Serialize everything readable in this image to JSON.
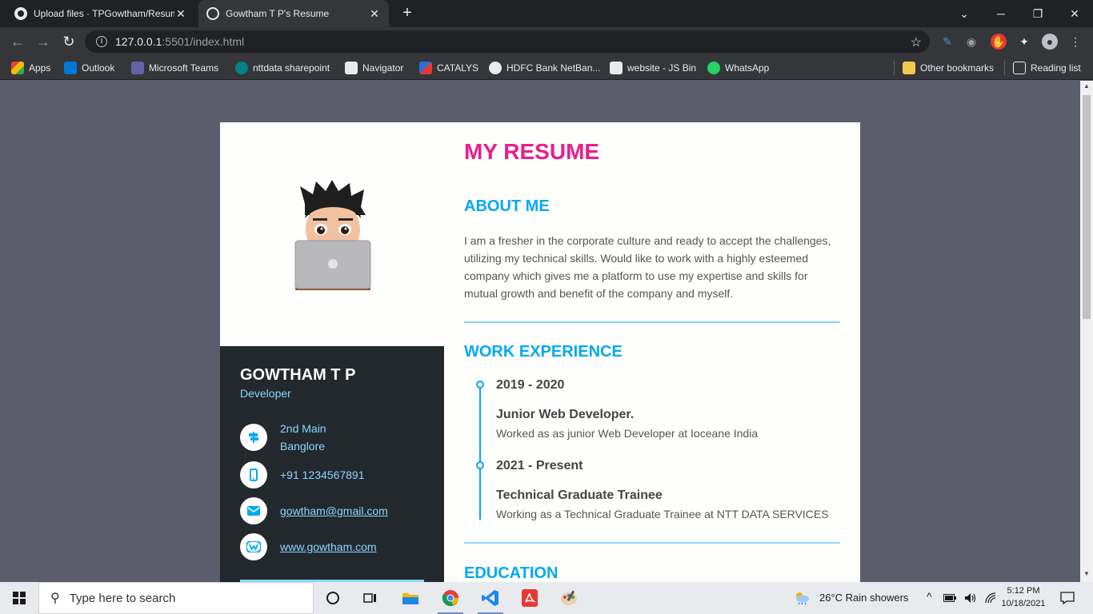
{
  "browser": {
    "tabs": [
      {
        "title": "Upload files · TPGowtham/Resum",
        "close": "✕"
      },
      {
        "title": "Gowtham T P's Resume",
        "close": "✕"
      }
    ],
    "new_tab": "+",
    "url_host": "127.0.0.1",
    "url_path": ":5501/index.html",
    "bookmarks": [
      {
        "label": "Apps",
        "color": "#ea4335"
      },
      {
        "label": "Outlook",
        "color": "#0078d4"
      },
      {
        "label": "Microsoft Teams",
        "color": "#6264a7"
      },
      {
        "label": "nttdata sharepoint",
        "color": "#038387"
      },
      {
        "label": "Navigator",
        "color": "#e8eaed"
      },
      {
        "label": "CATALYS",
        "color": "#2d6fd3"
      },
      {
        "label": "HDFC Bank NetBan...",
        "color": "#e8eaed"
      },
      {
        "label": "website - JS Bin",
        "color": "#e8eaed"
      },
      {
        "label": "WhatsApp",
        "color": "#25d366"
      }
    ],
    "other_bookmarks": "Other bookmarks",
    "reading_list": "Reading list"
  },
  "resume": {
    "title": "MY RESUME",
    "name": "GOWTHAM T P",
    "role": "Developer",
    "contact": {
      "address_line1": "2nd Main",
      "address_line2": "Banglore",
      "phone": "+91 1234567891",
      "email": "gowtham@gmail.com",
      "website": "www.gowtham.com"
    },
    "about": {
      "heading": "ABOUT ME",
      "text": "I am a fresher in the corporate culture and ready to accept the challenges, utilizing my technical skills. Would like to work with a highly esteemed company which gives me a platform to use my expertise and skills for mutual growth and benefit of the company and myself."
    },
    "work": {
      "heading": "WORK EXPERIENCE",
      "items": [
        {
          "years": "2019 - 2020",
          "job": "Junior Web Developer.",
          "desc": "Worked as as junior Web Developer at Ioceane India"
        },
        {
          "years": "2021 - Present",
          "job": "Technical Graduate Trainee",
          "desc": "Working as a Technical Graduate Trainee at NTT DATA SERVICES"
        }
      ]
    },
    "education": {
      "heading": "EDUCATION"
    }
  },
  "taskbar": {
    "search_placeholder": "Type here to search",
    "weather": "26°C  Rain showers",
    "time": "5:12 PM",
    "date": "10/18/2021"
  },
  "colors": {
    "accent_pink": "#e91e8c",
    "accent_blue": "#03a9f4",
    "panel_dark": "#23282d"
  }
}
